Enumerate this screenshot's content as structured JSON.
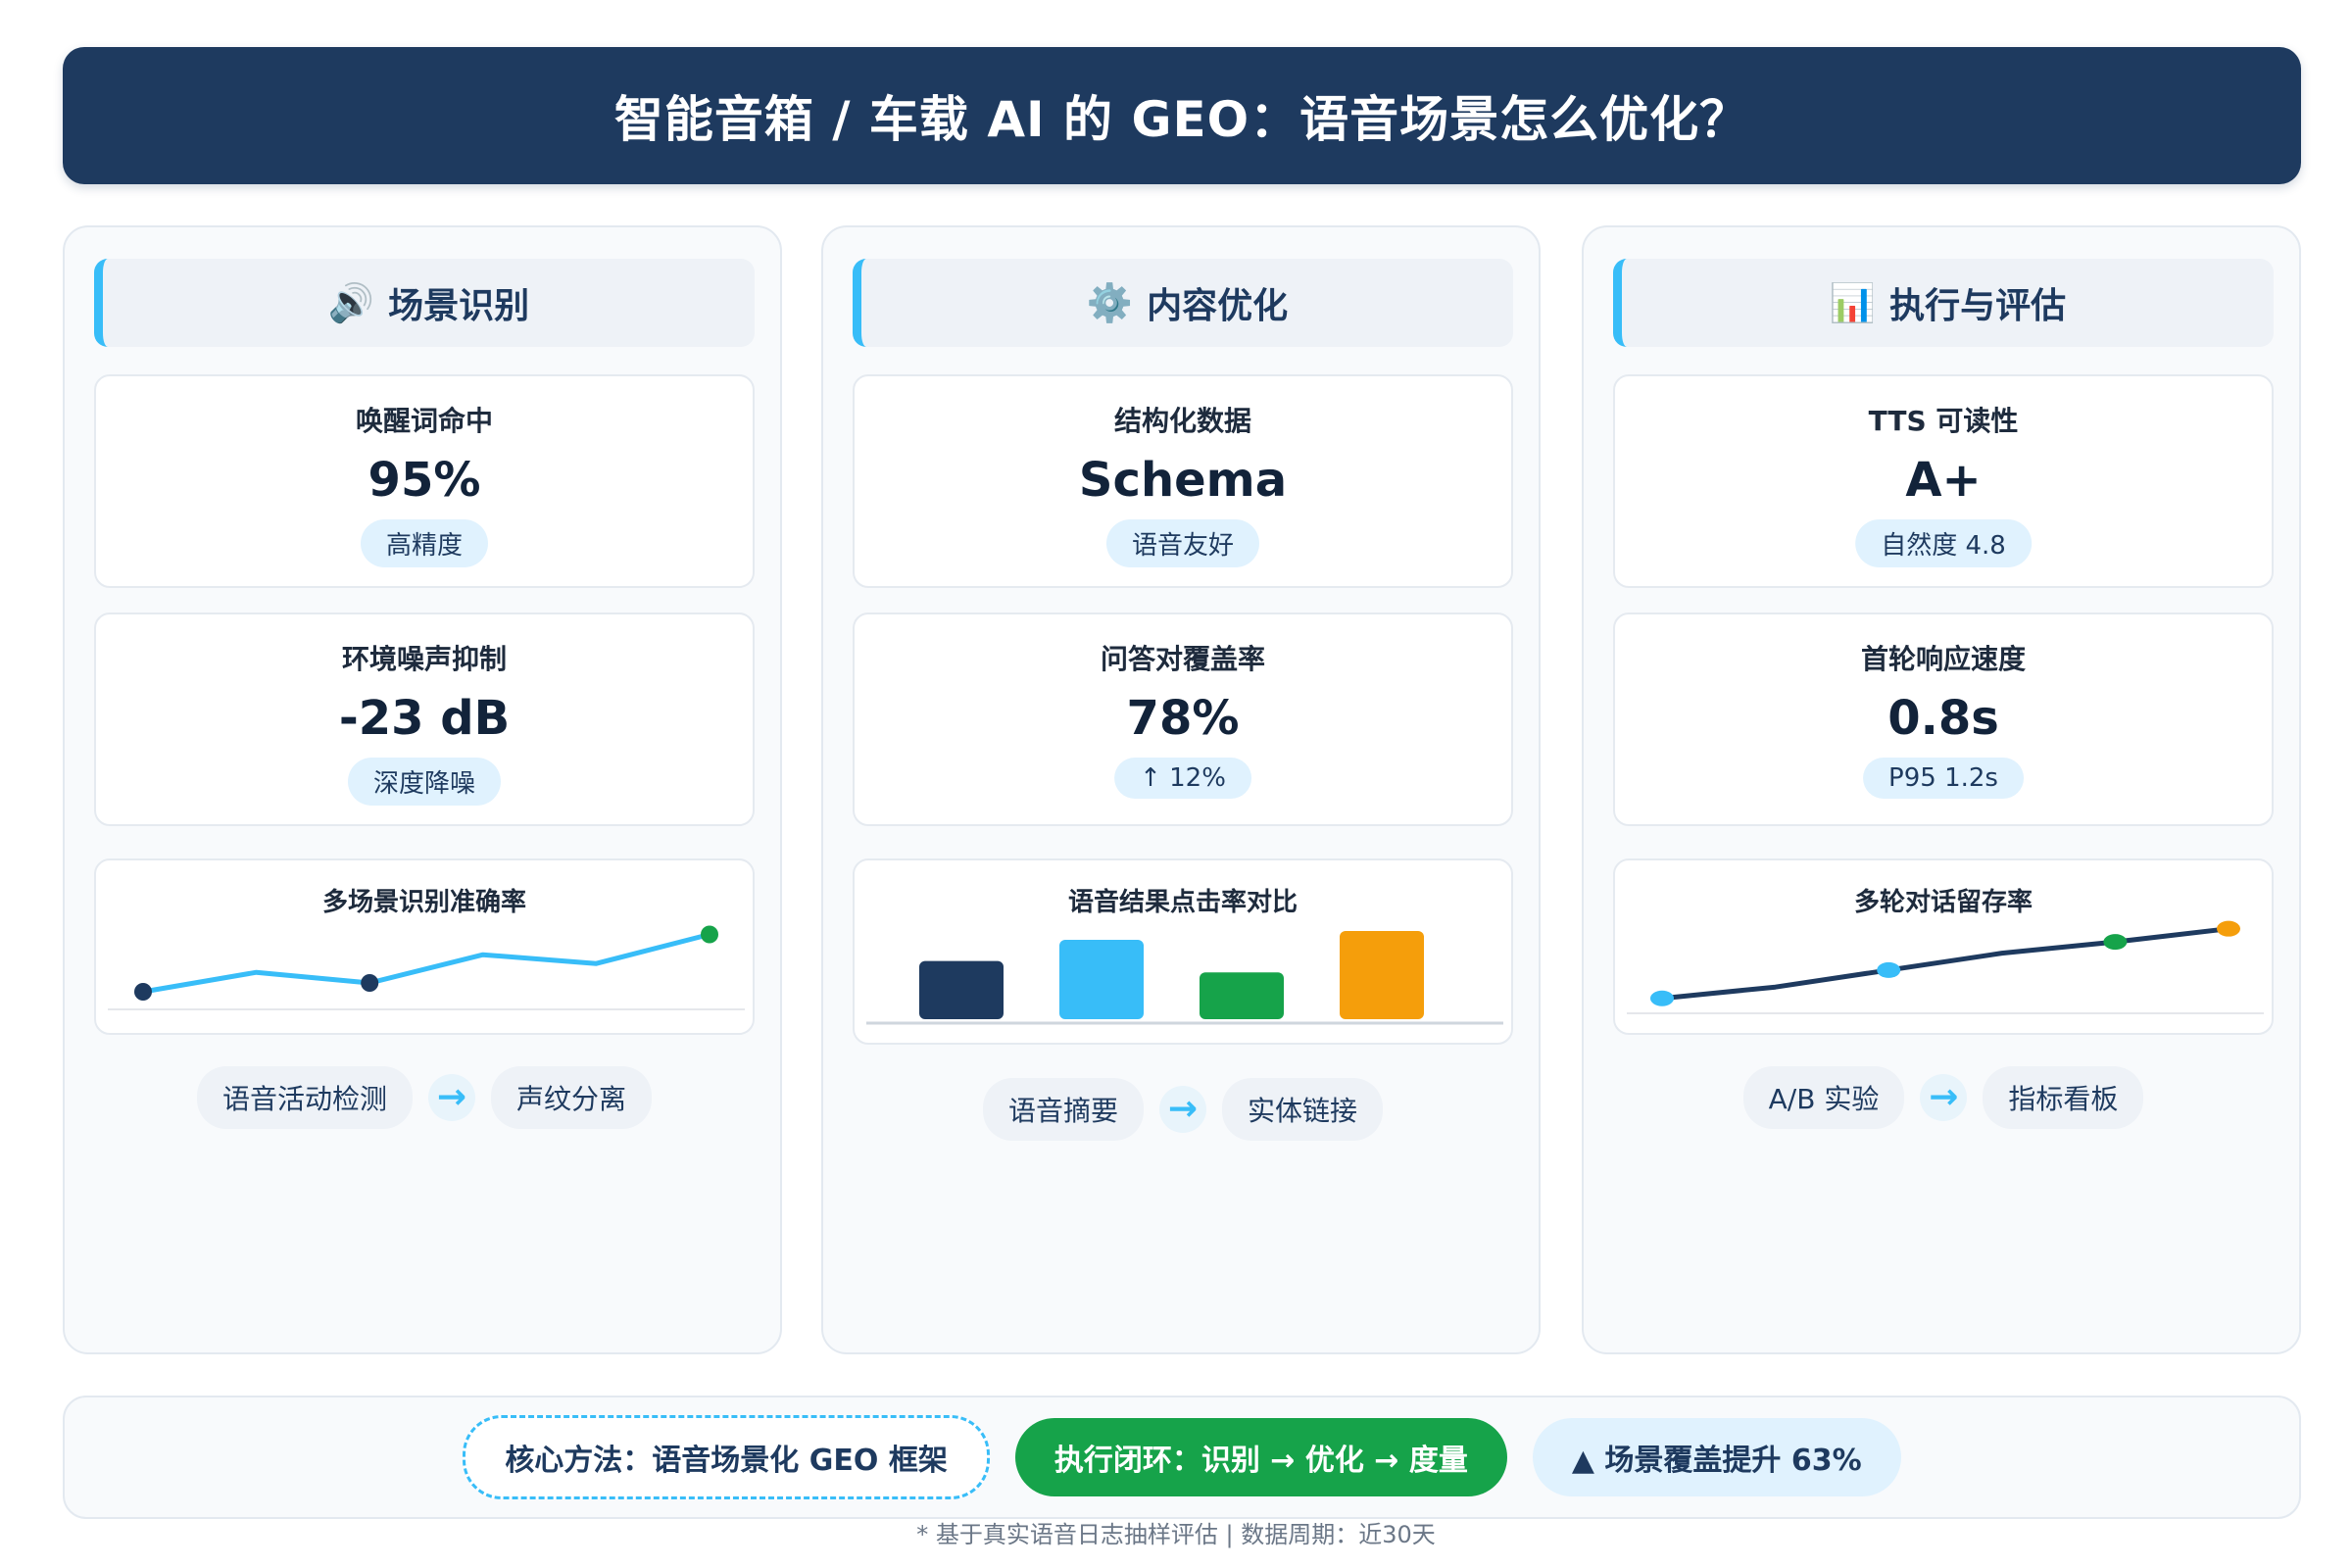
{
  "header": {
    "title": "智能音箱 / 车载 AI 的 GEO：语音场景怎么优化？"
  },
  "columns": [
    {
      "icon": "speaker-icon",
      "icon_glyph": "🔊",
      "title": "场景识别",
      "cards": [
        {
          "label": "唤醒词命中",
          "value": "95%",
          "pill": "高精度"
        },
        {
          "label": "环境噪声抑制",
          "value": "-23 dB",
          "pill": "深度降噪"
        }
      ],
      "flow": [
        "语音活动检测",
        "声纹分离"
      ]
    },
    {
      "icon": "gear-icon",
      "icon_glyph": "⚙️",
      "title": "内容优化",
      "cards": [
        {
          "label": "结构化数据",
          "value": "Schema",
          "pill": "语音友好"
        },
        {
          "label": "问答对覆盖率",
          "value": "78%",
          "pill": "↑ 12%"
        }
      ],
      "flow": [
        "语音摘要",
        "实体链接"
      ]
    },
    {
      "icon": "bar-chart-icon",
      "icon_glyph": "📊",
      "title": "执行与评估",
      "cards": [
        {
          "label": "TTS 可读性",
          "value": "A+",
          "pill": "自然度 4.8"
        },
        {
          "label": "首轮响应速度",
          "value": "0.8s",
          "pill": "P95 1.2s"
        }
      ],
      "flow": [
        "A/B 实验",
        "指标看板"
      ]
    }
  ],
  "chart_data": [
    {
      "type": "line",
      "title": "多场景识别准确率",
      "x": [
        0,
        1,
        2,
        3,
        4,
        5
      ],
      "series": [
        {
          "values": [
            0.2,
            0.42,
            0.3,
            0.62,
            0.52,
            0.85
          ]
        }
      ],
      "colors": {
        "line": "#38bdf8",
        "marker_dark": "#1e3a5f",
        "marker_green": "#16a34a"
      }
    },
    {
      "type": "bar",
      "title": "语音结果点击率对比",
      "categories": [
        "",
        "",
        "",
        ""
      ],
      "values": [
        0.66,
        0.9,
        0.53,
        1.0
      ],
      "colors": [
        "#1e3a5f",
        "#38bdf8",
        "#16a34a",
        "#f59e0b"
      ]
    },
    {
      "type": "line",
      "title": "多轮对话留存率",
      "x": [
        0,
        1,
        2,
        3,
        4,
        5
      ],
      "series": [
        {
          "values": [
            0.18,
            0.3,
            0.48,
            0.66,
            0.78,
            0.92
          ]
        }
      ],
      "colors": {
        "line": "#1e3a5f",
        "marker_sky": "#38bdf8",
        "marker_green": "#16a34a",
        "marker_amber": "#f59e0b"
      }
    }
  ],
  "footer": {
    "method": "核心方法：语音场景化 GEO 框架",
    "loop": "执行闭环：识别 → 优化 → 度量",
    "boost": "▲ 场景覆盖提升 63%"
  },
  "note": "* 基于真实语音日志抽样评估 | 数据周期：近30天"
}
